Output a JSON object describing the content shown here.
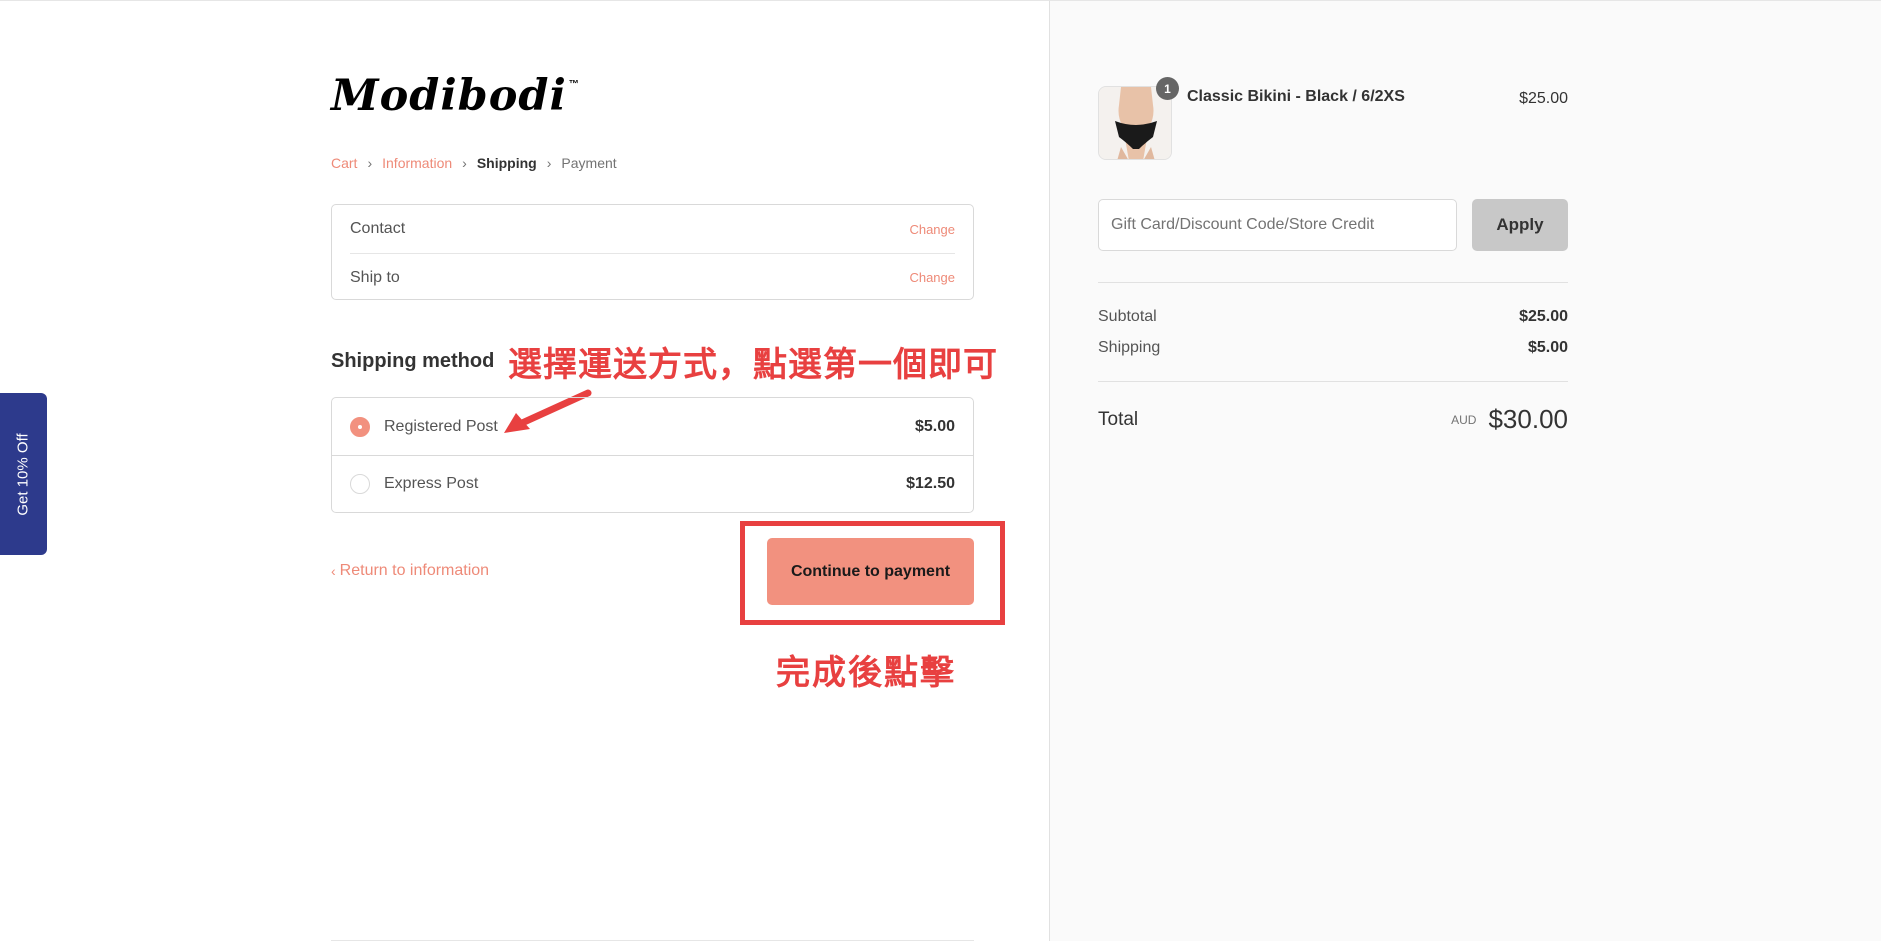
{
  "side_tab": {
    "label": "Get 10% Off"
  },
  "logo": {
    "text": "Modibodi",
    "tm": "™"
  },
  "breadcrumb": {
    "items": [
      "Cart",
      "Information",
      "Shipping",
      "Payment"
    ],
    "separator": "›"
  },
  "review": {
    "contact_label": "Contact",
    "contact_change": "Change",
    "ship_label": "Ship to",
    "ship_change": "Change"
  },
  "shipping": {
    "title": "Shipping method",
    "methods": [
      {
        "label": "Registered Post",
        "price": "$5.00",
        "selected": true
      },
      {
        "label": "Express Post",
        "price": "$12.50",
        "selected": false
      }
    ]
  },
  "annotations": {
    "choose_method": "選擇運送方式，點選第一個即可",
    "click_after": "完成後點擊",
    "highlight_color": "#e84040"
  },
  "actions": {
    "return_label": "Return to information",
    "continue_label": "Continue to payment"
  },
  "summary": {
    "product": {
      "name": "Classic Bikini - Black / 6/2XS",
      "price": "$25.00",
      "quantity": "1"
    },
    "discount": {
      "placeholder": "Gift Card/Discount Code/Store Credit",
      "apply_label": "Apply"
    },
    "subtotal_label": "Subtotal",
    "subtotal_value": "$25.00",
    "shipping_label": "Shipping",
    "shipping_value": "$5.00",
    "total_label": "Total",
    "currency": "AUD",
    "total_value": "$30.00"
  },
  "colors": {
    "accent": "#f2917f",
    "link": "#ee8a78",
    "side_tab": "#2d3a8c"
  }
}
